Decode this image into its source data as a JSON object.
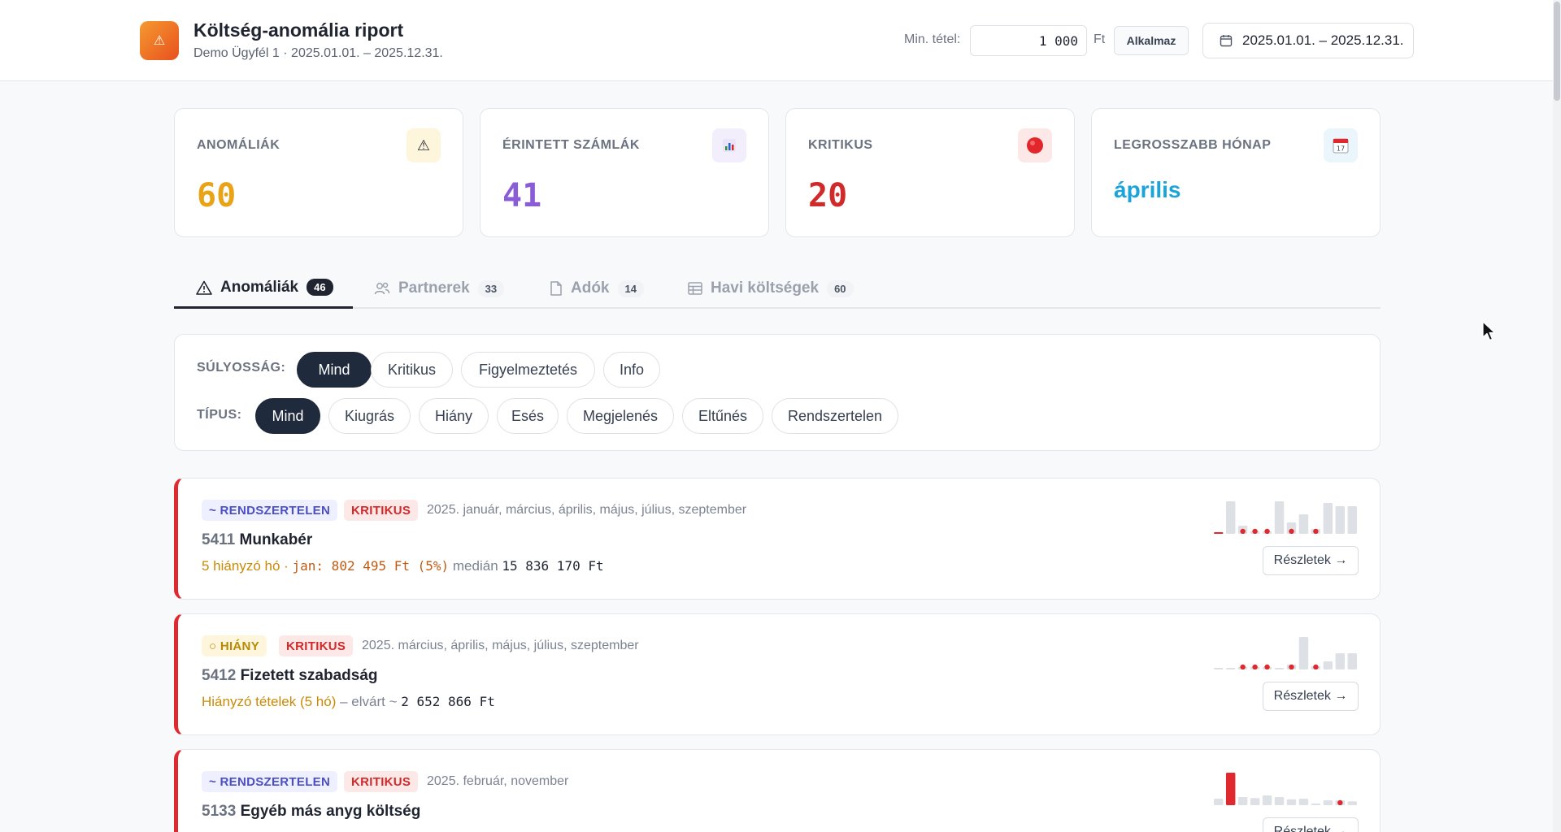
{
  "header": {
    "logo_glyph": "⚠",
    "title": "Költség-anomália riport",
    "subtitle": "Demo Ügyfél 1 · 2025.01.01. – 2025.12.31.",
    "min_label": "Min. tétel:",
    "min_value": "1 000",
    "currency": "Ft",
    "apply_label": "Alkalmaz",
    "date_range": "2025.01.01. – 2025.12.31."
  },
  "stats": [
    {
      "label": "ANOMÁLIÁK",
      "value": "60",
      "icon": "warning-icon",
      "glyph": "⚠",
      "color": "#e8a317",
      "icon_bg": "#fdf6dc"
    },
    {
      "label": "ÉRINTETT SZÁMLÁK",
      "value": "41",
      "icon": "bar-chart-icon",
      "glyph": "📊",
      "color": "#8a5cd6",
      "icon_bg": "#f3eefc"
    },
    {
      "label": "KRITIKUS",
      "value": "20",
      "icon": "red-circle-icon",
      "glyph": "●",
      "color": "#d12a2a",
      "icon_bg": "#fde8e8"
    },
    {
      "label": "LEGROSSZABB HÓNAP",
      "value": "április",
      "icon": "calendar-icon",
      "glyph": "📅",
      "color": "#1ba4d9",
      "icon_bg": "#eaf6fc"
    }
  ],
  "tabs": [
    {
      "label": "Anomáliák",
      "count": "46",
      "icon": "warning-icon"
    },
    {
      "label": "Partnerek",
      "count": "33",
      "icon": "users-icon"
    },
    {
      "label": "Adók",
      "count": "14",
      "icon": "document-icon"
    },
    {
      "label": "Havi költségek",
      "count": "60",
      "icon": "table-icon"
    }
  ],
  "filters": {
    "severity_label": "SÚLYOSSÁG:",
    "severity": [
      "Mind",
      "Kritikus",
      "Figyelmeztetés",
      "Info"
    ],
    "type_label": "TÍPUS:",
    "types": [
      "Mind",
      "Kiugrás",
      "Hiány",
      "Esés",
      "Megjelenés",
      "Eltűnés",
      "Rendszertelen"
    ]
  },
  "anomalies": [
    {
      "type_badge": "~ RENDSZERTELEN",
      "severity_badge": "KRITIKUS",
      "months": "2025. január, március, április, május, július, szeptember",
      "code": "5411",
      "name": "Munkabér",
      "detail_a": "5 hiányzó hó · ",
      "detail_b": "jan: 802 495 Ft (5%)",
      "detail_c": " medián ",
      "detail_d": "15 836 170 Ft",
      "button": "Részletek →"
    },
    {
      "type_badge": "○ HIÁNY",
      "severity_badge": "KRITIKUS",
      "months": "2025. március, április, május, július, szeptember",
      "code": "5412",
      "name": "Fizetett szabadság",
      "detail_a": "Hiányzó tételek (5 hó)",
      "detail_b": "",
      "detail_c": " – elvárt ~ ",
      "detail_d": "2 652 866 Ft",
      "button": "Részletek →"
    },
    {
      "type_badge": "~ RENDSZERTELEN",
      "severity_badge": "KRITIKUS",
      "months": "2025. február, november",
      "code": "5133",
      "name": "Egyéb más anyg költség",
      "detail_a": "",
      "detail_b": "",
      "detail_c": "",
      "detail_d": "",
      "button": "Részletek →"
    }
  ],
  "sparklines": [
    {
      "bars": [
        0.05,
        1.0,
        0.25,
        0.08,
        0.08,
        1.1,
        0.35,
        0.6,
        0.15,
        0.95,
        0.85,
        0.85
      ],
      "flags": [
        1,
        0,
        1,
        1,
        1,
        0,
        1,
        0,
        1,
        0,
        0,
        0
      ]
    },
    {
      "bars": [
        0.02,
        0.02,
        0.08,
        0.08,
        0.08,
        0.02,
        0.15,
        1.0,
        0.1,
        0.25,
        0.5,
        0.5
      ],
      "flags": [
        0,
        0,
        1,
        1,
        1,
        0,
        1,
        0,
        1,
        0,
        0,
        0
      ]
    },
    {
      "bars": [
        0.2,
        1.0,
        0.25,
        0.22,
        0.3,
        0.25,
        0.18,
        0.2,
        0.05,
        0.15,
        0.15,
        0.12
      ],
      "flags": [
        0,
        1,
        0,
        0,
        0,
        0,
        0,
        0,
        0,
        0,
        1,
        0
      ]
    }
  ]
}
